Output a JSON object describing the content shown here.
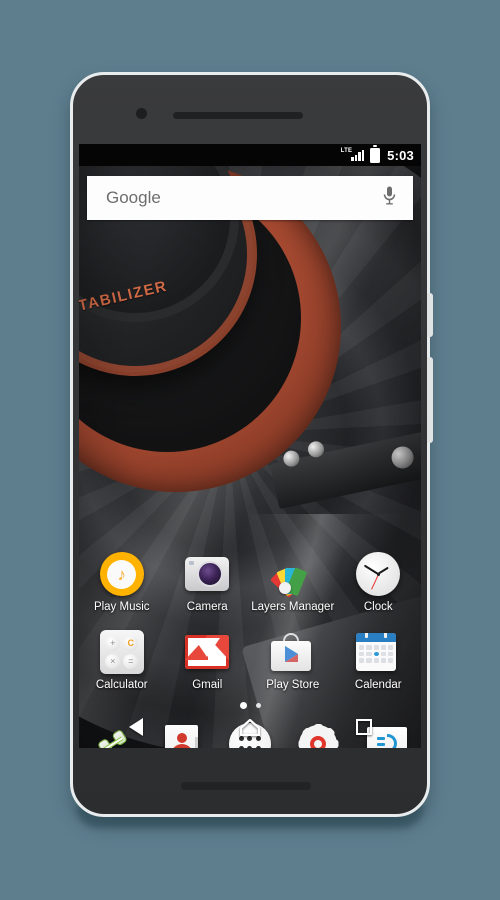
{
  "background": {
    "color": "#5e7e8e"
  },
  "device": {
    "name": "android-phone",
    "bezel_color": "#313234",
    "frame_color": "#e9eced",
    "front_camera": "front-camera",
    "earpiece": "earpiece-speaker",
    "bottom_speaker": "bottom-speaker",
    "buttons": [
      {
        "name": "power-button"
      },
      {
        "name": "volume-rocker"
      }
    ]
  },
  "statusbar": {
    "network_label": "LTE",
    "signal_icon": "signal-bars-icon",
    "signal_bars": 4,
    "battery_icon": "battery-icon",
    "time": "5:03",
    "background": "#050505",
    "foreground": "#ffffff"
  },
  "search": {
    "widget_name": "google-search-widget",
    "text": "Google",
    "placeholder": "Google",
    "mic_icon": "microphone-icon",
    "background": "#fdfdfd",
    "text_color": "#6d6d6d"
  },
  "wallpaper": {
    "name": "vinyl-record-wallpaper",
    "text": "STABILIZER",
    "label_color": "#ab4c33",
    "text_color": "#d06a46"
  },
  "homescreen": {
    "rows": [
      {
        "apps": [
          {
            "label": "Play Music",
            "icon": "play-music-icon"
          },
          {
            "label": "Camera",
            "icon": "camera-icon"
          },
          {
            "label": "Layers Manager",
            "icon": "layers-manager-icon"
          },
          {
            "label": "Clock",
            "icon": "clock-icon"
          }
        ]
      },
      {
        "apps": [
          {
            "label": "Calculator",
            "icon": "calculator-icon"
          },
          {
            "label": "Gmail",
            "icon": "gmail-icon"
          },
          {
            "label": "Play Store",
            "icon": "play-store-icon"
          },
          {
            "label": "Calendar",
            "icon": "calendar-icon"
          }
        ]
      }
    ],
    "calculator_keys": [
      "+",
      "C",
      "×",
      "="
    ],
    "page_indicator": {
      "total": 2,
      "active_index": 0
    }
  },
  "dock": {
    "items": [
      {
        "name": "phone",
        "icon": "phone-icon"
      },
      {
        "name": "contacts",
        "icon": "contacts-icon"
      },
      {
        "name": "app-drawer",
        "icon": "app-drawer-icon"
      },
      {
        "name": "settings",
        "icon": "settings-gear-icon"
      },
      {
        "name": "messaging",
        "icon": "messaging-icon"
      }
    ]
  },
  "navbar": {
    "buttons": [
      {
        "name": "back",
        "icon": "back-triangle-icon"
      },
      {
        "name": "home",
        "icon": "home-icon"
      },
      {
        "name": "recents",
        "icon": "recents-square-icon"
      }
    ]
  }
}
